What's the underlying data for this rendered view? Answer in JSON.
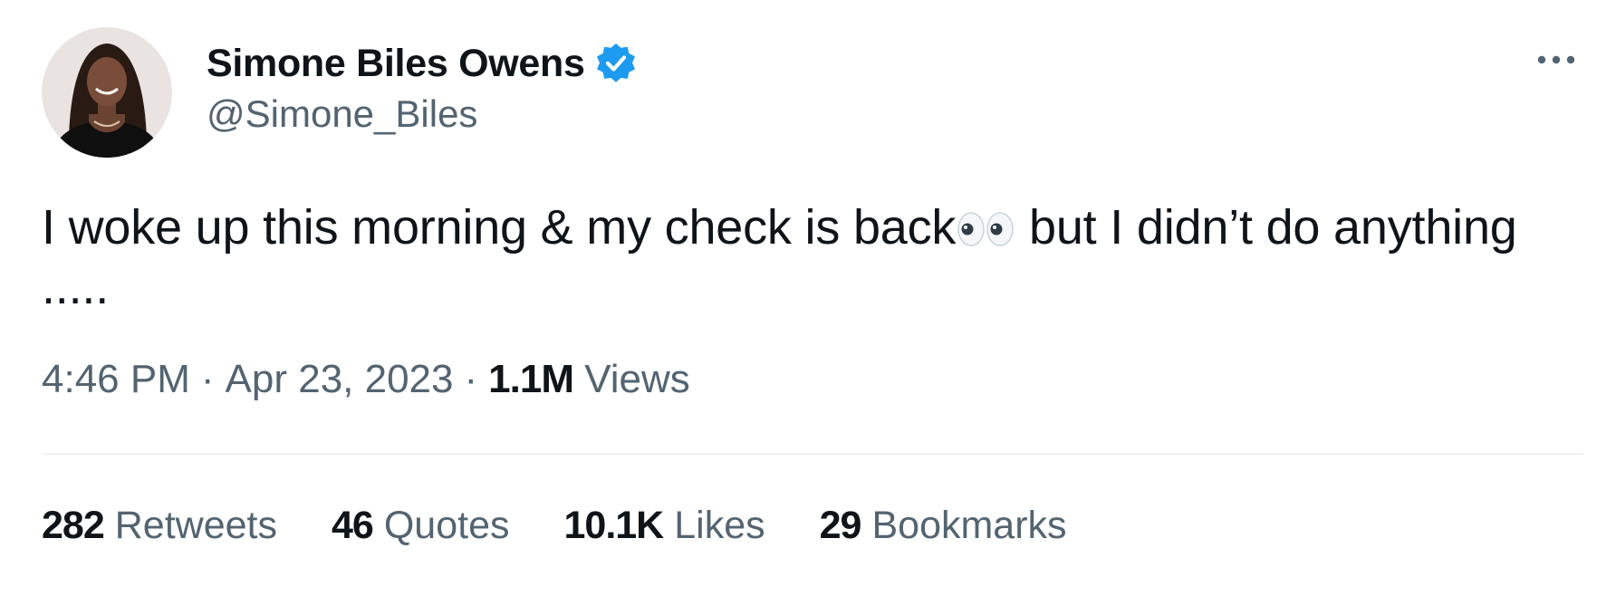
{
  "author": {
    "display_name": "Simone Biles Owens",
    "handle": "@Simone_Biles",
    "verified": true,
    "avatar_icon": "profile-photo"
  },
  "colors": {
    "text_primary": "#0f1419",
    "text_secondary": "#536471",
    "verified_blue": "#1d9bf0",
    "divider": "#eff3f4"
  },
  "tweet": {
    "text_before_emoji": "I woke up this morning & my check is back",
    "emoji": "eyes-icon",
    "text_after_emoji": " but I didn’t do anything\n.....",
    "time": "4:46 PM",
    "separator": "·",
    "date": "Apr 23, 2023",
    "views_count": "1.1M",
    "views_label": "Views"
  },
  "stats": [
    {
      "count": "282",
      "label": "Retweets"
    },
    {
      "count": "46",
      "label": "Quotes"
    },
    {
      "count": "10.1K",
      "label": "Likes"
    },
    {
      "count": "29",
      "label": "Bookmarks"
    }
  ],
  "more_icon": "more-horizontal-icon"
}
